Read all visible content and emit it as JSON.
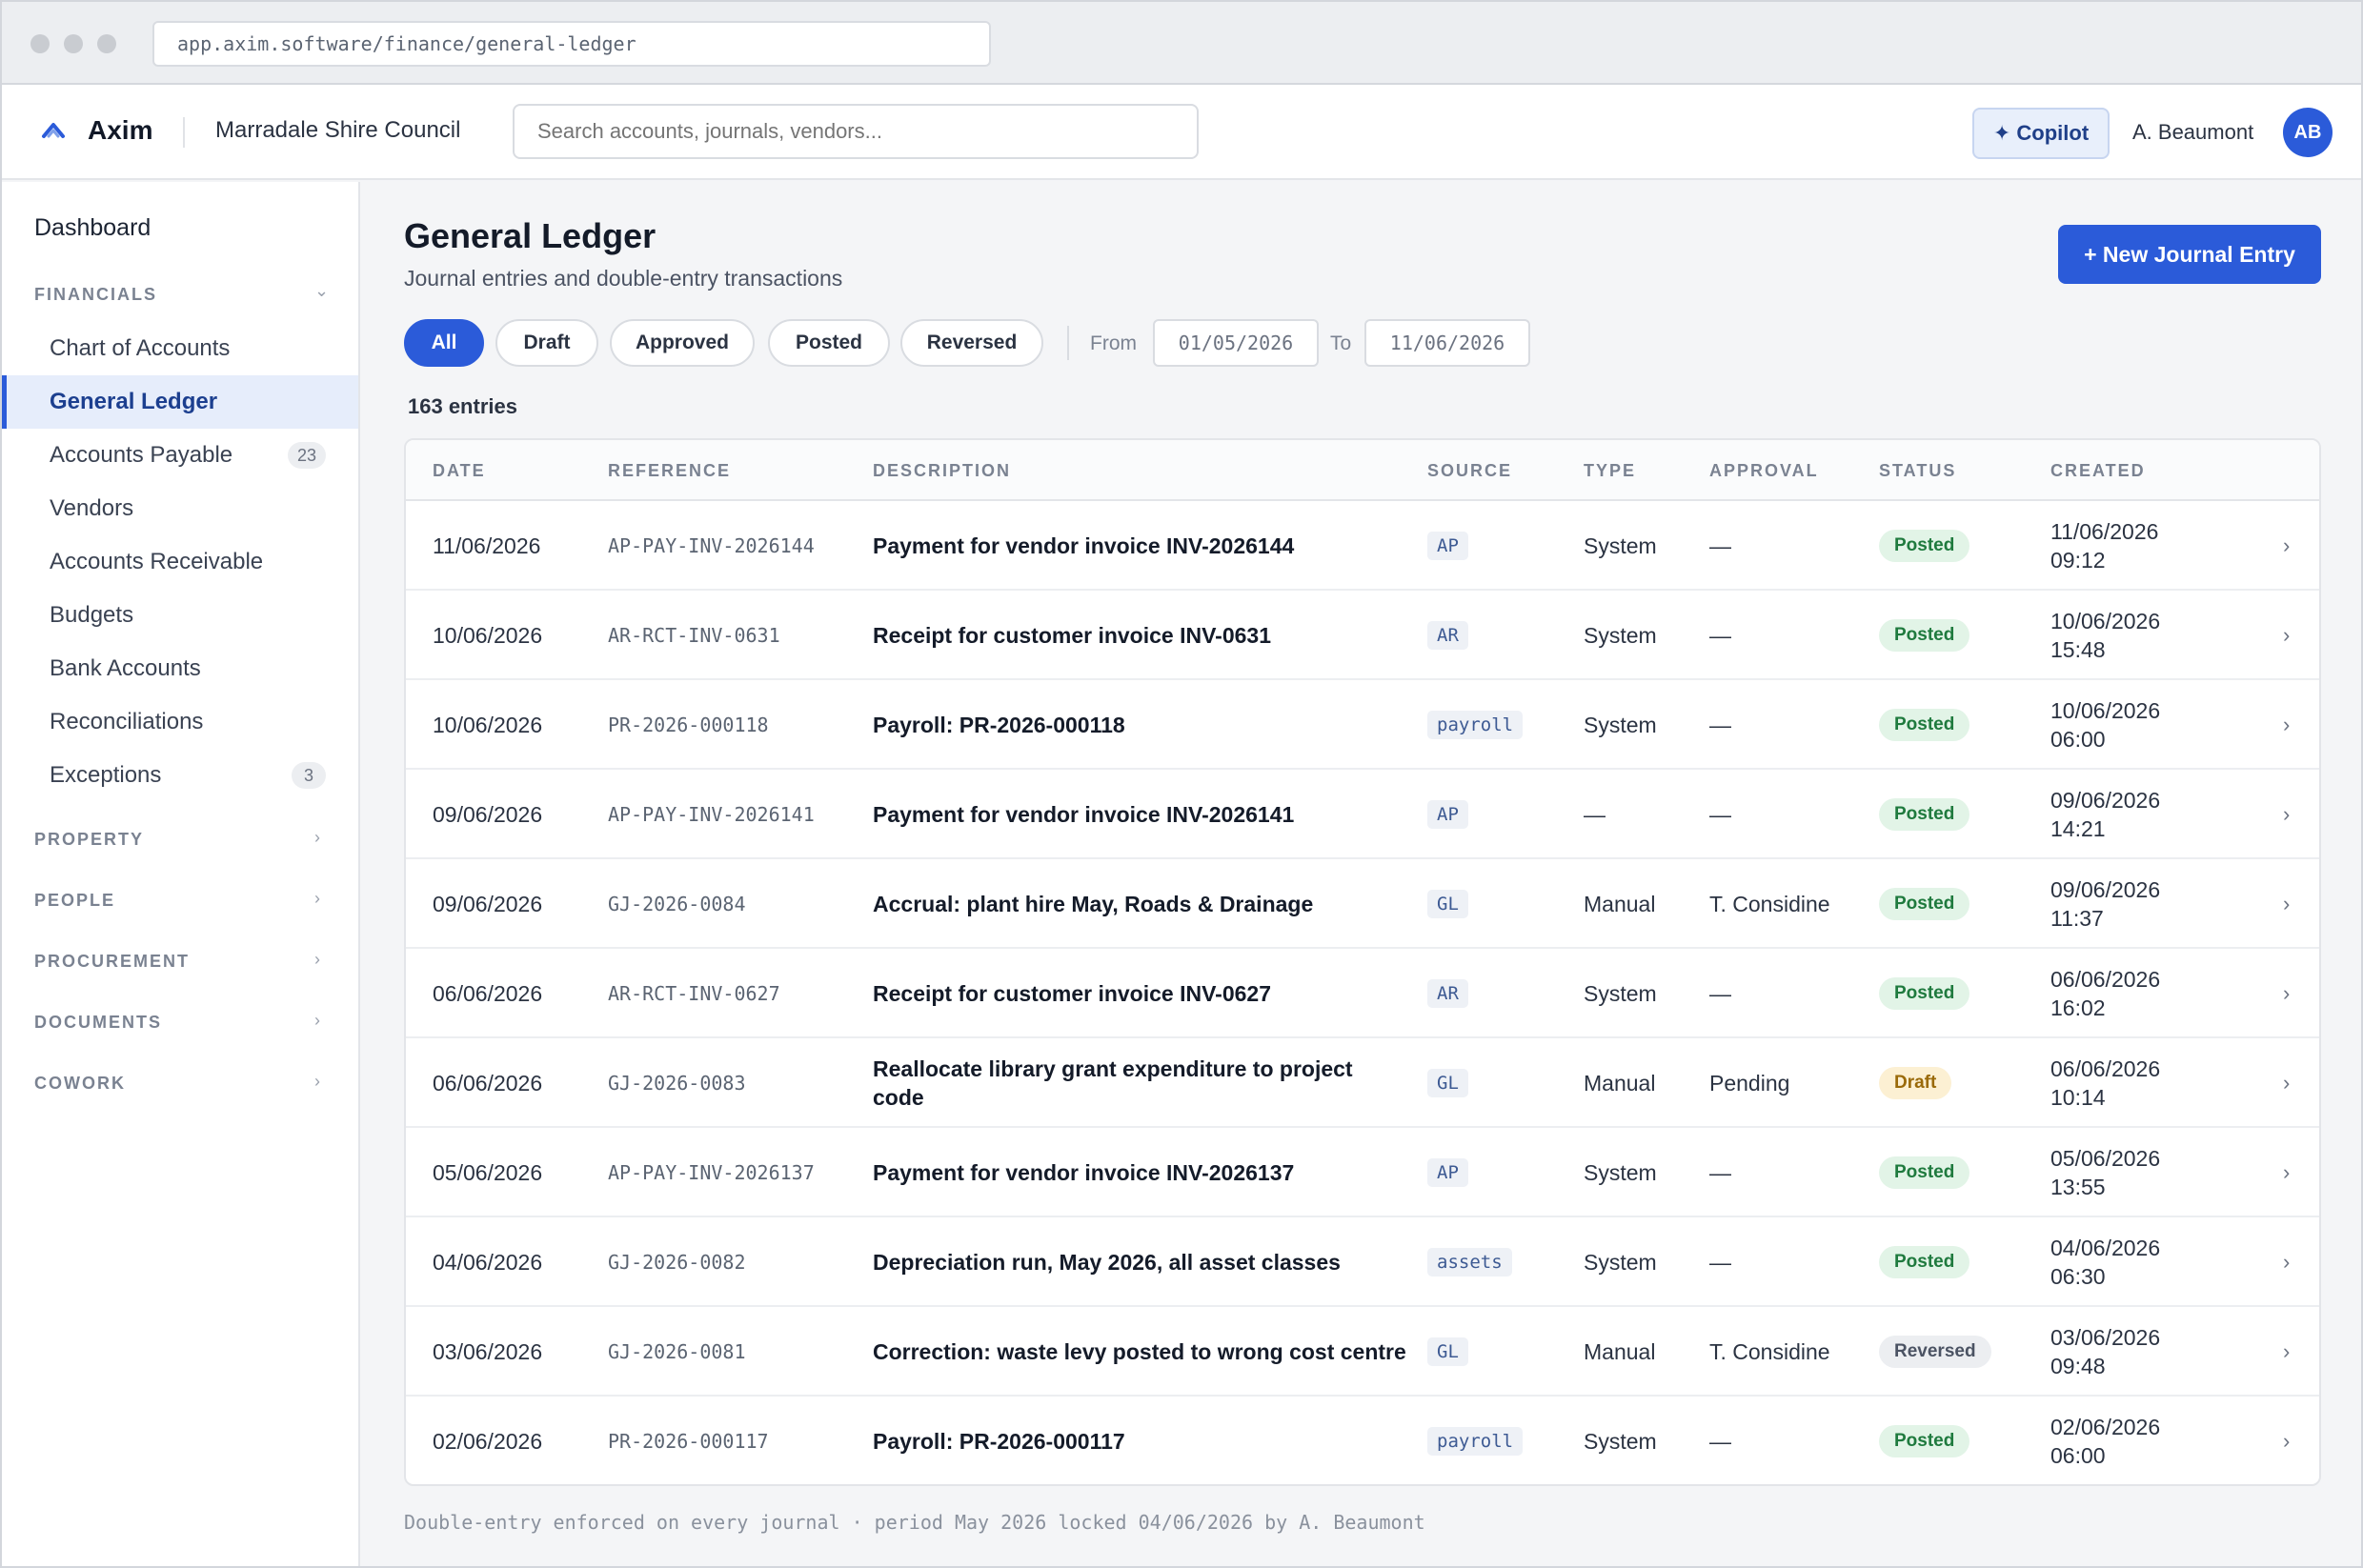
{
  "browser": {
    "url": "app.axim.software/finance/general-ledger"
  },
  "header": {
    "brand": "Axim",
    "org": "Marradale Shire Council",
    "search_placeholder": "Search accounts, journals, vendors...",
    "copilot_label": "✦ Copilot",
    "user_name": "A. Beaumont",
    "avatar_initials": "AB"
  },
  "sidebar": {
    "dashboard": "Dashboard",
    "financials": {
      "title": "FINANCIALS",
      "items": [
        {
          "label": "Chart of Accounts",
          "badge": null
        },
        {
          "label": "General Ledger",
          "badge": null
        },
        {
          "label": "Accounts Payable",
          "badge": "23"
        },
        {
          "label": "Vendors",
          "badge": null
        },
        {
          "label": "Accounts Receivable",
          "badge": null
        },
        {
          "label": "Budgets",
          "badge": null
        },
        {
          "label": "Bank Accounts",
          "badge": null
        },
        {
          "label": "Reconciliations",
          "badge": null
        },
        {
          "label": "Exceptions",
          "badge": "3"
        }
      ]
    },
    "sections": [
      "PROPERTY",
      "PEOPLE",
      "PROCUREMENT",
      "DOCUMENTS",
      "COWORK"
    ]
  },
  "page": {
    "title": "General Ledger",
    "subtitle": "Journal entries and double-entry transactions",
    "new_button": "+ New Journal Entry",
    "filters": [
      "All",
      "Draft",
      "Approved",
      "Posted",
      "Reversed"
    ],
    "from_label": "From",
    "from_date": "01/05/2026",
    "to_label": "To",
    "to_date": "11/06/2026",
    "entry_count": "163 entries",
    "footer_note": "Double-entry enforced on every journal · period May 2026 locked 04/06/2026 by A. Beaumont"
  },
  "table": {
    "columns": [
      "DATE",
      "REFERENCE",
      "DESCRIPTION",
      "SOURCE",
      "TYPE",
      "APPROVAL",
      "STATUS",
      "CREATED"
    ],
    "rows": [
      {
        "date": "11/06/2026",
        "reference": "AP-PAY-INV-2026144",
        "description": "Payment for vendor invoice INV-2026144",
        "source": "AP",
        "type": "System",
        "approval": "—",
        "status": "Posted",
        "created": "11/06/2026 09:12"
      },
      {
        "date": "10/06/2026",
        "reference": "AR-RCT-INV-0631",
        "description": "Receipt for customer invoice INV-0631",
        "source": "AR",
        "type": "System",
        "approval": "—",
        "status": "Posted",
        "created": "10/06/2026 15:48"
      },
      {
        "date": "10/06/2026",
        "reference": "PR-2026-000118",
        "description": "Payroll: PR-2026-000118",
        "source": "payroll",
        "type": "System",
        "approval": "—",
        "status": "Posted",
        "created": "10/06/2026 06:00"
      },
      {
        "date": "09/06/2026",
        "reference": "AP-PAY-INV-2026141",
        "description": "Payment for vendor invoice INV-2026141",
        "source": "AP",
        "type": "—",
        "approval": "—",
        "status": "Posted",
        "created": "09/06/2026 14:21"
      },
      {
        "date": "09/06/2026",
        "reference": "GJ-2026-0084",
        "description": "Accrual: plant hire May, Roads & Drainage",
        "source": "GL",
        "type": "Manual",
        "approval": "T. Considine",
        "status": "Posted",
        "created": "09/06/2026 11:37"
      },
      {
        "date": "06/06/2026",
        "reference": "AR-RCT-INV-0627",
        "description": "Receipt for customer invoice INV-0627",
        "source": "AR",
        "type": "System",
        "approval": "—",
        "status": "Posted",
        "created": "06/06/2026 16:02"
      },
      {
        "date": "06/06/2026",
        "reference": "GJ-2026-0083",
        "description": "Reallocate library grant expenditure to project code",
        "source": "GL",
        "type": "Manual",
        "approval": "Pending",
        "status": "Draft",
        "created": "06/06/2026 10:14"
      },
      {
        "date": "05/06/2026",
        "reference": "AP-PAY-INV-2026137",
        "description": "Payment for vendor invoice INV-2026137",
        "source": "AP",
        "type": "System",
        "approval": "—",
        "status": "Posted",
        "created": "05/06/2026 13:55"
      },
      {
        "date": "04/06/2026",
        "reference": "GJ-2026-0082",
        "description": "Depreciation run, May 2026, all asset classes",
        "source": "assets",
        "type": "System",
        "approval": "—",
        "status": "Posted",
        "created": "04/06/2026 06:30"
      },
      {
        "date": "03/06/2026",
        "reference": "GJ-2026-0081",
        "description": "Correction: waste levy posted to wrong cost centre",
        "source": "GL",
        "type": "Manual",
        "approval": "T. Considine",
        "status": "Reversed",
        "created": "03/06/2026 09:48"
      },
      {
        "date": "02/06/2026",
        "reference": "PR-2026-000117",
        "description": "Payroll: PR-2026-000117",
        "source": "payroll",
        "type": "System",
        "approval": "—",
        "status": "Posted",
        "created": "02/06/2026 06:00"
      }
    ]
  },
  "colors": {
    "accent": "#2b5bd9",
    "posted": "#1f7a3e",
    "draft": "#9a6a0a",
    "reversed": "#4b5363"
  },
  "icons": {
    "logo": "axim-chevron-icon",
    "chevron_row": "chevron-right-icon",
    "chevron_section": "chevron-icon"
  }
}
